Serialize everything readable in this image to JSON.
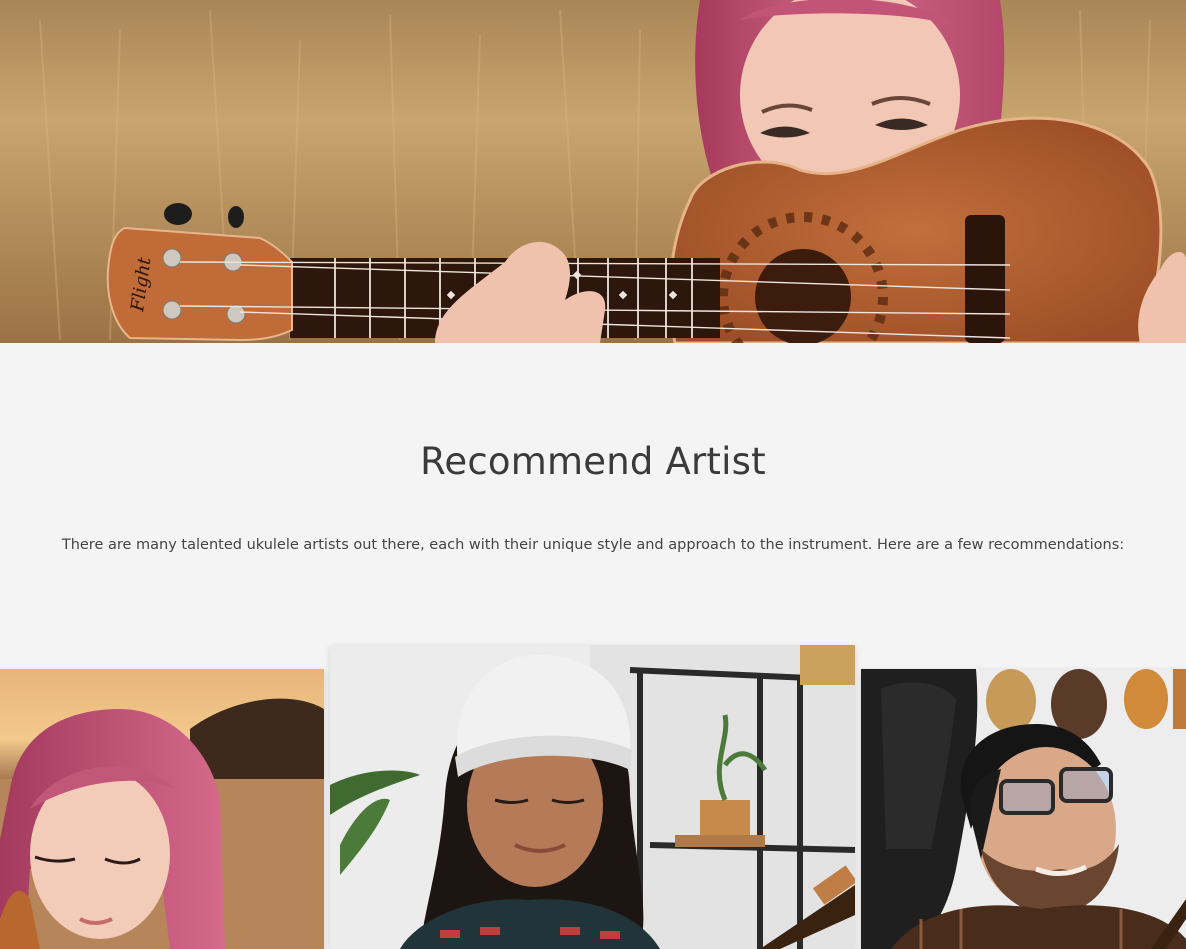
{
  "hero": {
    "image": "woman-with-pink-hair-holding-ukulele",
    "headstock_brand": "Flight"
  },
  "section": {
    "title": "Recommend Artist",
    "description": "There are many talented ukulele artists out there, each with their unique style and approach to the instrument. Here are a few recommendations:"
  },
  "artists": [
    {
      "image": "artist-pink-hair-sunset-field"
    },
    {
      "image": "artist-white-beanie-ukulele"
    },
    {
      "image": "artist-glasses-cap-ukulele-wall"
    }
  ]
}
